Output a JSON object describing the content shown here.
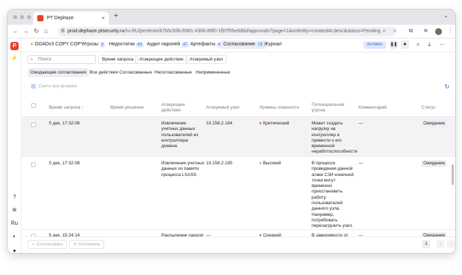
{
  "browser": {
    "tab_title": "PT Dephaze",
    "tab_close": "×",
    "new_tab": "+",
    "url_host": "prod.dephaze.ptsecurity.ru",
    "url_path": "/ru-RU/pentests/67b5c93b-6981-4308-89f0-1f97f55edd6d/approvals?page=1&orderBy=createdAt:desc&status=Pending"
  },
  "sidebar": {
    "logo": "P",
    "lang": "Ru"
  },
  "topnav": {
    "project": "GOADv3 COPY COPY",
    "tabs": [
      {
        "label": "Угрозы",
        "count": "3"
      },
      {
        "label": "Недостатки",
        "count": "43"
      },
      {
        "label": "Аудит паролей",
        "count": "47"
      },
      {
        "label": "Артефакты",
        "count": "4"
      },
      {
        "label": "Согласование",
        "count": "18"
      },
      {
        "label": "Журнал",
        "count": ""
      }
    ],
    "status": "Активен"
  },
  "toolbar": {
    "search_placeholder": "Поиск",
    "filters": [
      "Время запроса",
      "Атакующее действие",
      "Атакуемый узел"
    ],
    "status_tabs": [
      "Ожидающие согласования",
      "Все действия",
      "Согласованные",
      "Несогласованные",
      "Непримененные"
    ],
    "select_all": "Снять все флажки"
  },
  "table": {
    "headers": {
      "request_time": "Время запроса",
      "decision_time": "Время решения",
      "action": "Атакующее действие",
      "node": "Атакуемый узел",
      "severity": "Уровень опасности",
      "threat": "Потенциальная угроза",
      "comment": "Комментарий",
      "status": "Статус"
    },
    "rows": [
      {
        "request_time": "5 дек, 17:32:08",
        "action": "Извлечение учетных данных пользователей из контроллера домена",
        "node": "10.158.2.194",
        "severity": "Критический",
        "severity_color": "#e8412c",
        "threat": "Может создать нагрузку на контроллер и привести к его временной неработоспособности",
        "comment": "—",
        "status": "Ожидание"
      },
      {
        "request_time": "5 дек, 17:32:08",
        "action": "Извлечение учетных данных из памяти процесса LSASS",
        "node": "10.158.2.195",
        "severity": "Высокий",
        "severity_color": "#f08a24",
        "threat": "В процессе проведения данной атаки СЗИ конечной точки могут временно приостановить работу пользователей данного узла. Например, потребовать перезагрузить узел.",
        "comment": "—",
        "status": "Ожидание"
      },
      {
        "request_time": "5 дек, 15:24:14",
        "action": "Распыление пароля для обнаруженных",
        "node": "—",
        "severity": "Средний",
        "severity_color": "#3b6bd6",
        "threat": "В зависимости от используемой",
        "comment": "—",
        "status": "Ожидание"
      }
    ]
  },
  "footer": {
    "approve": "Согласовать",
    "reject": "Отклонить",
    "page": "1"
  }
}
